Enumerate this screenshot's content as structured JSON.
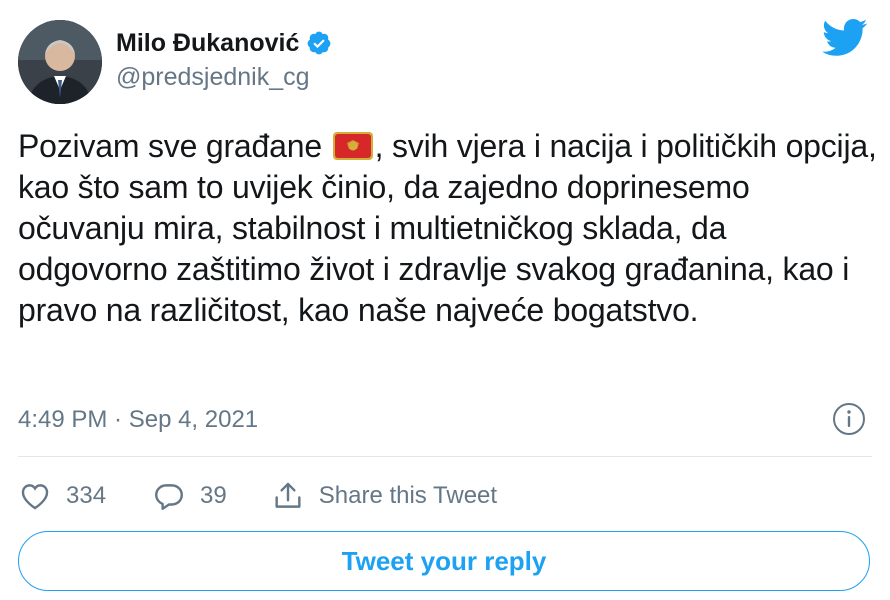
{
  "author": {
    "name": "Milo Đukanović",
    "handle": "@predsjednik_cg",
    "verified": true
  },
  "tweet": {
    "text_before_flag": "Pozivam sve građane ",
    "flag_icon": "montenegro-flag-emoji",
    "text_after_flag": ", svih vjera i nacija i političkih opcija, kao što sam to uvijek činio, da zajedno doprinesemo očuvanju mira, stabilnost i multietničkog sklada, da odgovorno zaštitimo život i zdravlje svakog građanina, kao i pravo na različitost, kao naše najveće bogatstvo.",
    "timestamp": "4:49 PM · Sep 4, 2021"
  },
  "actions": {
    "likes": "334",
    "replies": "39",
    "share_label": "Share this Tweet"
  },
  "reply_button_label": "Tweet your reply",
  "colors": {
    "brand_blue": "#1DA1F2",
    "text": "#14171A",
    "secondary": "#657786"
  },
  "icons": [
    "twitter-bird-icon",
    "verified-badge-icon",
    "info-icon",
    "heart-icon",
    "reply-bubble-icon",
    "share-icon"
  ]
}
